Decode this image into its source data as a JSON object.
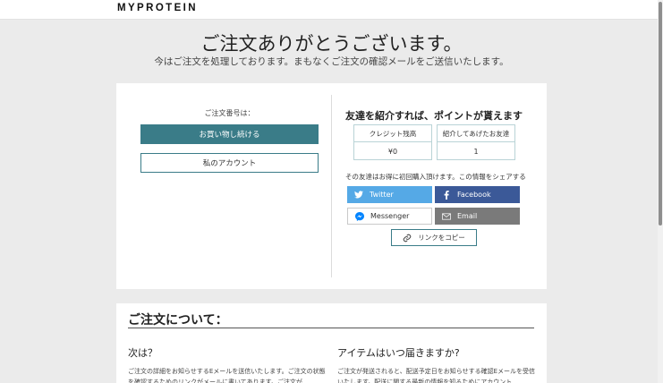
{
  "header": {
    "logo_text": "MYPROTEIN"
  },
  "confirmation": {
    "title": "ご注文ありがとうございます。",
    "subtitle": "今はご注文を処理しております。まもなくご注文の確認メールをご送信いたします。"
  },
  "order": {
    "number_label": "ご注文番号は：",
    "continue_shopping_label": "お買い物し続ける",
    "my_account_label": "私のアカウント"
  },
  "referral": {
    "title": "友達を紹介すれば、ポイントが貰えます",
    "credit_label": "クレジット残高",
    "credit_value": "¥0",
    "friends_label": "紹介してあげたお友達",
    "friends_value": "1",
    "share_text": "その友達はお得に初回購入頂けます。この情報をシェアする",
    "share_buttons": {
      "twitter": "Twitter",
      "facebook": "Facebook",
      "messenger": "Messenger",
      "email": "Email"
    },
    "copy_link_label": "リンクをコピー"
  },
  "about": {
    "title": "ご注文について：",
    "next_title": "次は？",
    "next_text": "ご注文の詳細をお知らせするEメールを送信いたします。ご注文の状態を確認するためのリンクがメールに書いてあります。ご注文が",
    "delivery_title": "アイテムはいつ届きますか?",
    "delivery_text": "ご注文が発送されると、配送予定日をお知らせする確認Eメールを受信いたします。配送に関する最新の情報を知るためにアカウント"
  },
  "colors": {
    "accent": "#3a7c88",
    "twitter": "#55a9e6",
    "facebook": "#3b5998",
    "email": "#7a7a7a",
    "messenger": "#0084ff"
  }
}
